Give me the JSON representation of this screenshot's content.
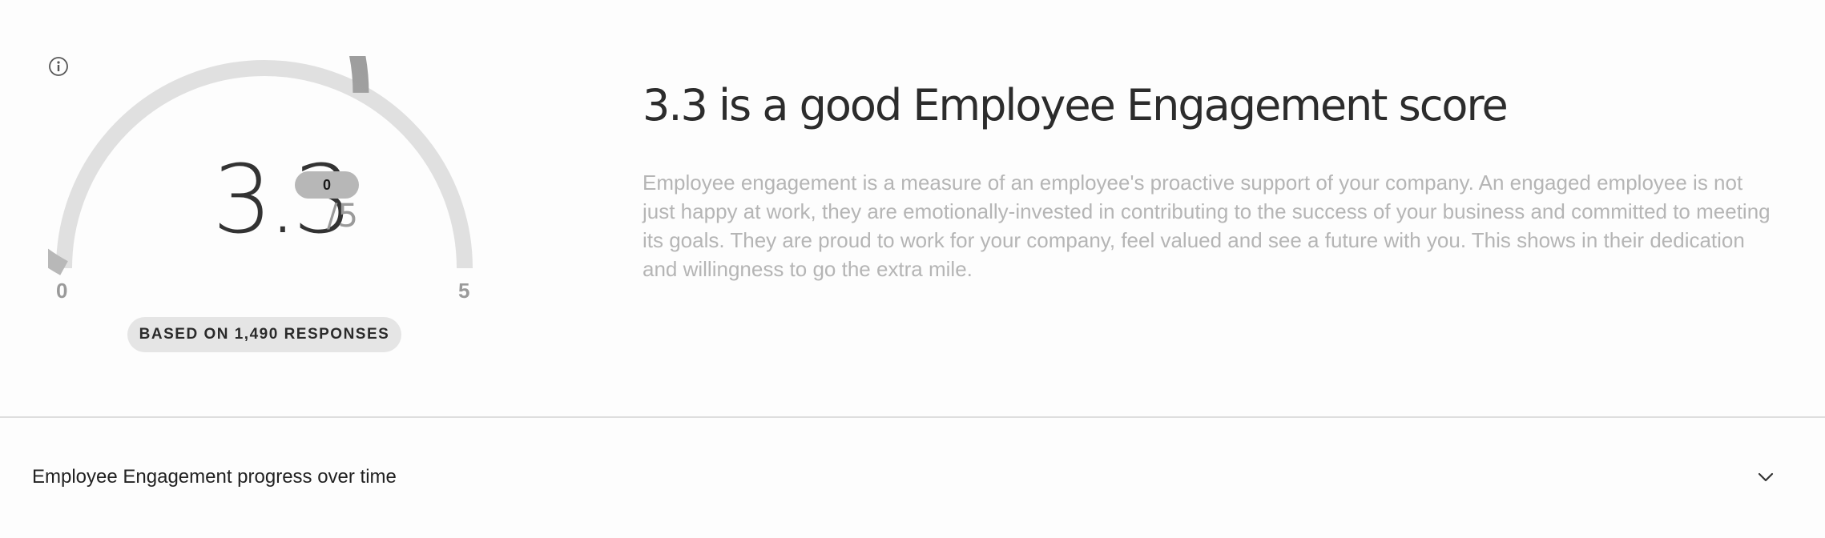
{
  "score": {
    "value": "3.3",
    "max_label": "/5",
    "badge": "0",
    "score_numeric": 3.3,
    "scale_min": 0,
    "scale_max": 5,
    "min_label": "0",
    "max_tick_label": "5",
    "responses_label": "BASED ON 1,490 RESPONSES"
  },
  "headline": "3.3 is a good Employee Engagement score",
  "description": "Employee engagement is a measure of an employee's proactive support of your company. An engaged employee is not just happy at work, they are emotionally-invested in contributing to the success of your business and committed to meeting its goals. They are proud to work for your company, feel valued and see a future with you. This shows in their dedication and willingness to go the extra mile.",
  "accordion": {
    "title": "Employee Engagement progress over time",
    "icon": "chevron-down-icon"
  },
  "icons": {
    "info": "info-icon"
  },
  "colors": {
    "gauge_fill": "#999999",
    "gauge_track": "#e0e0e0",
    "badge_bg": "#b7b7b7",
    "responses_bg": "#e5e5e5",
    "description_text": "#b5b5b5"
  }
}
